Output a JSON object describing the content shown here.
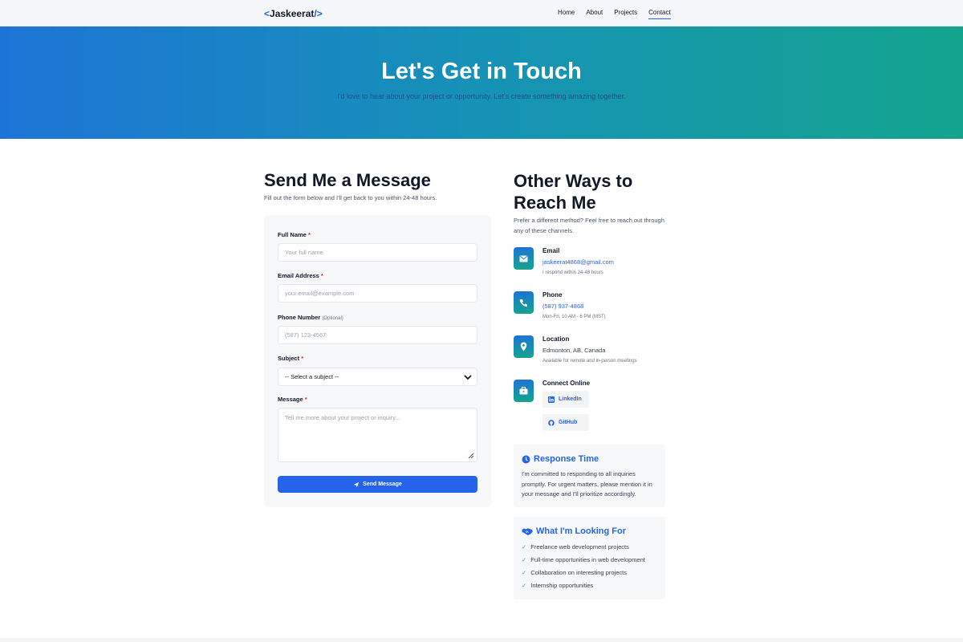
{
  "nav": {
    "logo_open": "<",
    "logo_name": "Jaskeerat",
    "logo_close": "/>",
    "links": [
      "Home",
      "About",
      "Projects",
      "Contact"
    ],
    "active": "Contact"
  },
  "hero": {
    "title": "Let's Get in Touch",
    "subtitle": "I'd love to hear about your project or opportunity. Let's create something amazing together."
  },
  "form": {
    "title": "Send Me a Message",
    "subtitle": "Fill out the form below and I'll get back to you within 24-48 hours.",
    "name_label": "Full Name",
    "name_placeholder": "Your full name",
    "email_label": "Email Address",
    "email_placeholder": "your.email@example.com",
    "phone_label": "Phone Number",
    "phone_optional": "(Optional)",
    "phone_placeholder": "(587) 123-4567",
    "subject_label": "Subject",
    "subject_selected": "-- Select a subject --",
    "message_label": "Message",
    "message_placeholder": "Tell me more about your project or inquiry...",
    "required_mark": "*",
    "submit_label": "Send Message"
  },
  "contact": {
    "title": "Other Ways to Reach Me",
    "subtitle": "Prefer a different method? Feel free to reach out through any of these channels.",
    "email_title": "Email",
    "email_value": "jaskeerat4868@gmail.com",
    "email_note": "I respond within 24-48 hours",
    "phone_title": "Phone",
    "phone_value": "(587) 937-4868",
    "phone_note": "Mon-Fri, 10 AM - 6 PM (MST)",
    "location_title": "Location",
    "location_value": "Edmonton, AB, Canada",
    "location_note": "Available for remote and in-person meetings",
    "online_title": "Connect Online",
    "linkedin_label": "LinkedIn",
    "github_label": "GitHub"
  },
  "response": {
    "title": "Response Time",
    "body": "I'm committed to responding to all inquiries promptly. For urgent matters, please mention it in your message and I'll prioritize accordingly."
  },
  "looking": {
    "title": "What I'm Looking For",
    "check": "✓",
    "items": [
      "Freelance web development projects",
      "Full-time opportunities in web development",
      "Collaboration on interesting projects",
      "Internship opportunities"
    ]
  },
  "colors": {
    "accent": "#2563eb",
    "gradient_start": "#1d74d6",
    "gradient_end": "#14a48e",
    "required": "#dc2626"
  }
}
